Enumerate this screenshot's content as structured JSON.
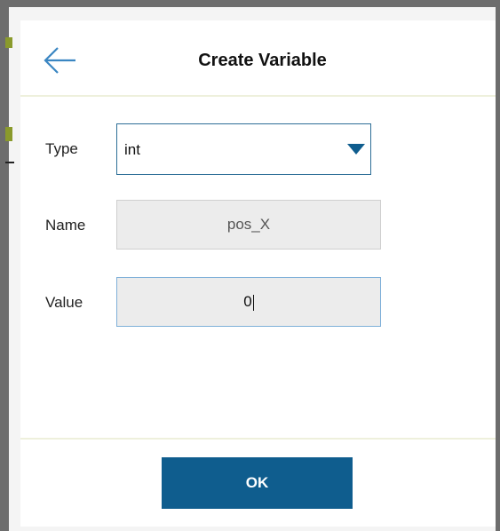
{
  "dialog": {
    "title": "Create Variable",
    "back_icon": "arrow-left-icon"
  },
  "form": {
    "type": {
      "label": "Type",
      "value": "int",
      "icon": "dropdown-caret-icon"
    },
    "name": {
      "label": "Name",
      "value": "pos_X"
    },
    "value": {
      "label": "Value",
      "value": "0"
    }
  },
  "footer": {
    "ok_label": "OK"
  },
  "colors": {
    "accent": "#0f5d8e",
    "back_arrow": "#3a86c2",
    "field_bg": "#ececec",
    "divider": "#eef0dc"
  }
}
